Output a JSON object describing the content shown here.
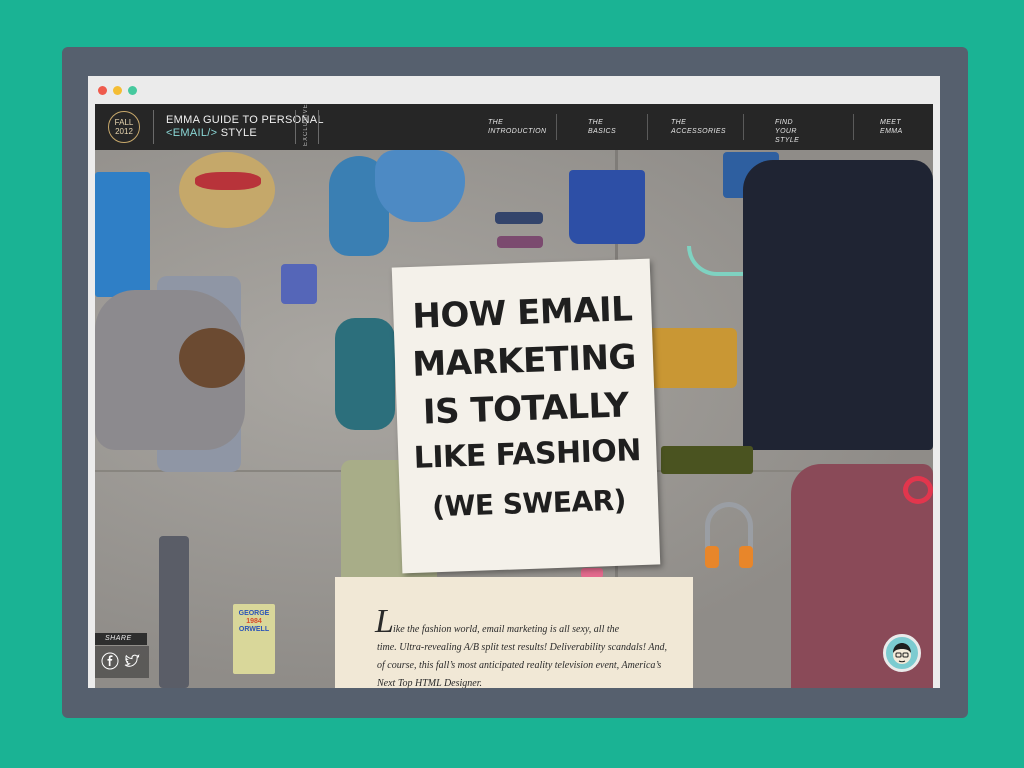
{
  "window": {
    "traffic_lights": [
      "close",
      "minimize",
      "maximize"
    ]
  },
  "navbar": {
    "badge_line1": "FALL",
    "badge_line2": "2012",
    "brand_line1": "EMMA GUIDE TO PERSONAL",
    "brand_code": "<EMAIL/>",
    "brand_style": "STYLE",
    "exclusive": "EXCLUSIVE",
    "links": [
      {
        "line1": "THE",
        "line2": "INTRODUCTION"
      },
      {
        "line1": "THE",
        "line2": "BASICS"
      },
      {
        "line1": "THE",
        "line2": "ACCESSORIES"
      },
      {
        "line1": "FIND",
        "line2": "YOUR STYLE"
      },
      {
        "line1": "MEET",
        "line2": "EMMA"
      }
    ]
  },
  "hero": {
    "poster_lines": [
      "HOW EMAIL",
      "MARKETING",
      "IS TOTALLY",
      "LIKE FASHION",
      "(WE SWEAR)"
    ],
    "book_lines": [
      "GEORGE",
      "1984",
      "ORWELL"
    ]
  },
  "article": {
    "dropcap": "L",
    "first_line": "ike the fashion world, email marketing is all sexy, all the",
    "rest": "time. Ultra-revealing A/B split test results! Deliverability scandals! And, of course, this fall’s most anticipated reality television event, America’s Next Top HTML Designer."
  },
  "share": {
    "label": "SHARE",
    "icons": [
      "facebook-icon",
      "twitter-icon"
    ]
  },
  "colors": {
    "background": "#1ab394",
    "frame": "#56606e",
    "navbar": "#262626",
    "accent_gold": "#c7a86b",
    "code_cyan": "#8ad7d6",
    "article_bg": "#f1e8d6"
  }
}
